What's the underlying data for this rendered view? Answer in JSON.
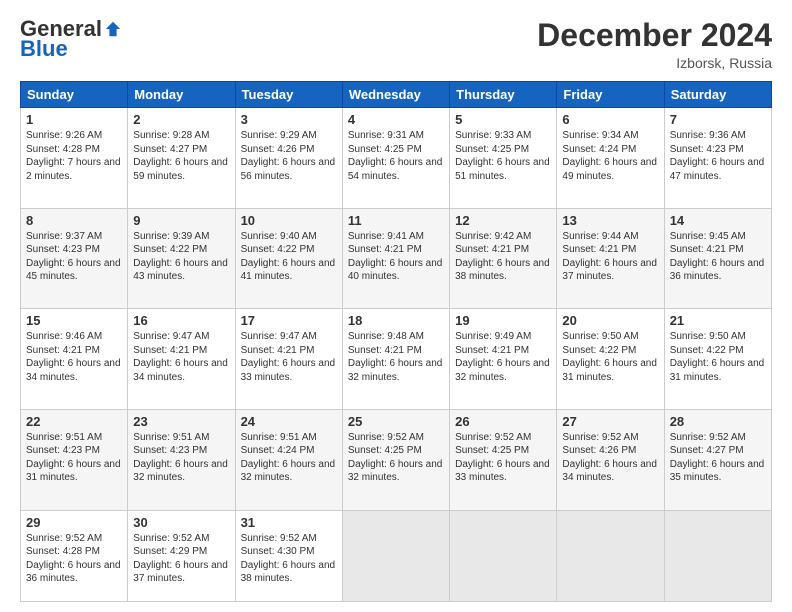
{
  "header": {
    "logo_general": "General",
    "logo_blue": "Blue",
    "month_title": "December 2024",
    "location": "Izborsk, Russia"
  },
  "days_of_week": [
    "Sunday",
    "Monday",
    "Tuesday",
    "Wednesday",
    "Thursday",
    "Friday",
    "Saturday"
  ],
  "weeks": [
    [
      {
        "num": "1",
        "rise": "9:26 AM",
        "set": "4:28 PM",
        "daylight": "7 hours and 2 minutes."
      },
      {
        "num": "2",
        "rise": "9:28 AM",
        "set": "4:27 PM",
        "daylight": "6 hours and 59 minutes."
      },
      {
        "num": "3",
        "rise": "9:29 AM",
        "set": "4:26 PM",
        "daylight": "6 hours and 56 minutes."
      },
      {
        "num": "4",
        "rise": "9:31 AM",
        "set": "4:25 PM",
        "daylight": "6 hours and 54 minutes."
      },
      {
        "num": "5",
        "rise": "9:33 AM",
        "set": "4:25 PM",
        "daylight": "6 hours and 51 minutes."
      },
      {
        "num": "6",
        "rise": "9:34 AM",
        "set": "4:24 PM",
        "daylight": "6 hours and 49 minutes."
      },
      {
        "num": "7",
        "rise": "9:36 AM",
        "set": "4:23 PM",
        "daylight": "6 hours and 47 minutes."
      }
    ],
    [
      {
        "num": "8",
        "rise": "9:37 AM",
        "set": "4:23 PM",
        "daylight": "6 hours and 45 minutes."
      },
      {
        "num": "9",
        "rise": "9:39 AM",
        "set": "4:22 PM",
        "daylight": "6 hours and 43 minutes."
      },
      {
        "num": "10",
        "rise": "9:40 AM",
        "set": "4:22 PM",
        "daylight": "6 hours and 41 minutes."
      },
      {
        "num": "11",
        "rise": "9:41 AM",
        "set": "4:21 PM",
        "daylight": "6 hours and 40 minutes."
      },
      {
        "num": "12",
        "rise": "9:42 AM",
        "set": "4:21 PM",
        "daylight": "6 hours and 38 minutes."
      },
      {
        "num": "13",
        "rise": "9:44 AM",
        "set": "4:21 PM",
        "daylight": "6 hours and 37 minutes."
      },
      {
        "num": "14",
        "rise": "9:45 AM",
        "set": "4:21 PM",
        "daylight": "6 hours and 36 minutes."
      }
    ],
    [
      {
        "num": "15",
        "rise": "9:46 AM",
        "set": "4:21 PM",
        "daylight": "6 hours and 34 minutes."
      },
      {
        "num": "16",
        "rise": "9:47 AM",
        "set": "4:21 PM",
        "daylight": "6 hours and 34 minutes."
      },
      {
        "num": "17",
        "rise": "9:47 AM",
        "set": "4:21 PM",
        "daylight": "6 hours and 33 minutes."
      },
      {
        "num": "18",
        "rise": "9:48 AM",
        "set": "4:21 PM",
        "daylight": "6 hours and 32 minutes."
      },
      {
        "num": "19",
        "rise": "9:49 AM",
        "set": "4:21 PM",
        "daylight": "6 hours and 32 minutes."
      },
      {
        "num": "20",
        "rise": "9:50 AM",
        "set": "4:22 PM",
        "daylight": "6 hours and 31 minutes."
      },
      {
        "num": "21",
        "rise": "9:50 AM",
        "set": "4:22 PM",
        "daylight": "6 hours and 31 minutes."
      }
    ],
    [
      {
        "num": "22",
        "rise": "9:51 AM",
        "set": "4:23 PM",
        "daylight": "6 hours and 31 minutes."
      },
      {
        "num": "23",
        "rise": "9:51 AM",
        "set": "4:23 PM",
        "daylight": "6 hours and 32 minutes."
      },
      {
        "num": "24",
        "rise": "9:51 AM",
        "set": "4:24 PM",
        "daylight": "6 hours and 32 minutes."
      },
      {
        "num": "25",
        "rise": "9:52 AM",
        "set": "4:25 PM",
        "daylight": "6 hours and 32 minutes."
      },
      {
        "num": "26",
        "rise": "9:52 AM",
        "set": "4:25 PM",
        "daylight": "6 hours and 33 minutes."
      },
      {
        "num": "27",
        "rise": "9:52 AM",
        "set": "4:26 PM",
        "daylight": "6 hours and 34 minutes."
      },
      {
        "num": "28",
        "rise": "9:52 AM",
        "set": "4:27 PM",
        "daylight": "6 hours and 35 minutes."
      }
    ],
    [
      {
        "num": "29",
        "rise": "9:52 AM",
        "set": "4:28 PM",
        "daylight": "6 hours and 36 minutes."
      },
      {
        "num": "30",
        "rise": "9:52 AM",
        "set": "4:29 PM",
        "daylight": "6 hours and 37 minutes."
      },
      {
        "num": "31",
        "rise": "9:52 AM",
        "set": "4:30 PM",
        "daylight": "6 hours and 38 minutes."
      },
      null,
      null,
      null,
      null
    ]
  ]
}
